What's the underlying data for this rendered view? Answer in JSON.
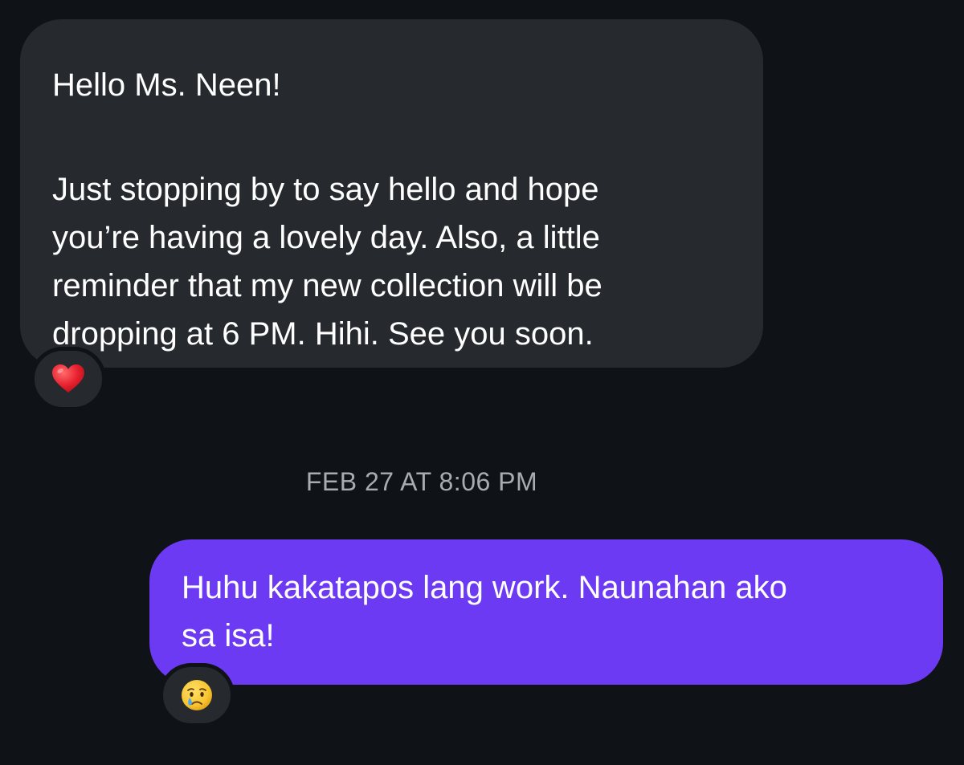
{
  "messages": {
    "incoming": {
      "greeting": "Hello Ms. Neen!",
      "body_lines": [
        "Just stopping by to say hello and hope",
        "you’re having a lovely day. Also, a little",
        "reminder that my new collection will be",
        "dropping at 6 PM. Hihi. See you soon."
      ],
      "reaction": "heart-emoji"
    },
    "timestamp": "FEB 27 AT 8:06 PM",
    "outgoing": {
      "lines": [
        "Huhu kakatapos lang work. Naunahan ako",
        "sa isa!"
      ],
      "reaction": "crying-face-emoji"
    }
  },
  "colors": {
    "background": "#0f1317",
    "incoming_bubble": "#262a2f",
    "outgoing_bubble": "#6c3af2",
    "timestamp_text": "#a8acb2"
  }
}
